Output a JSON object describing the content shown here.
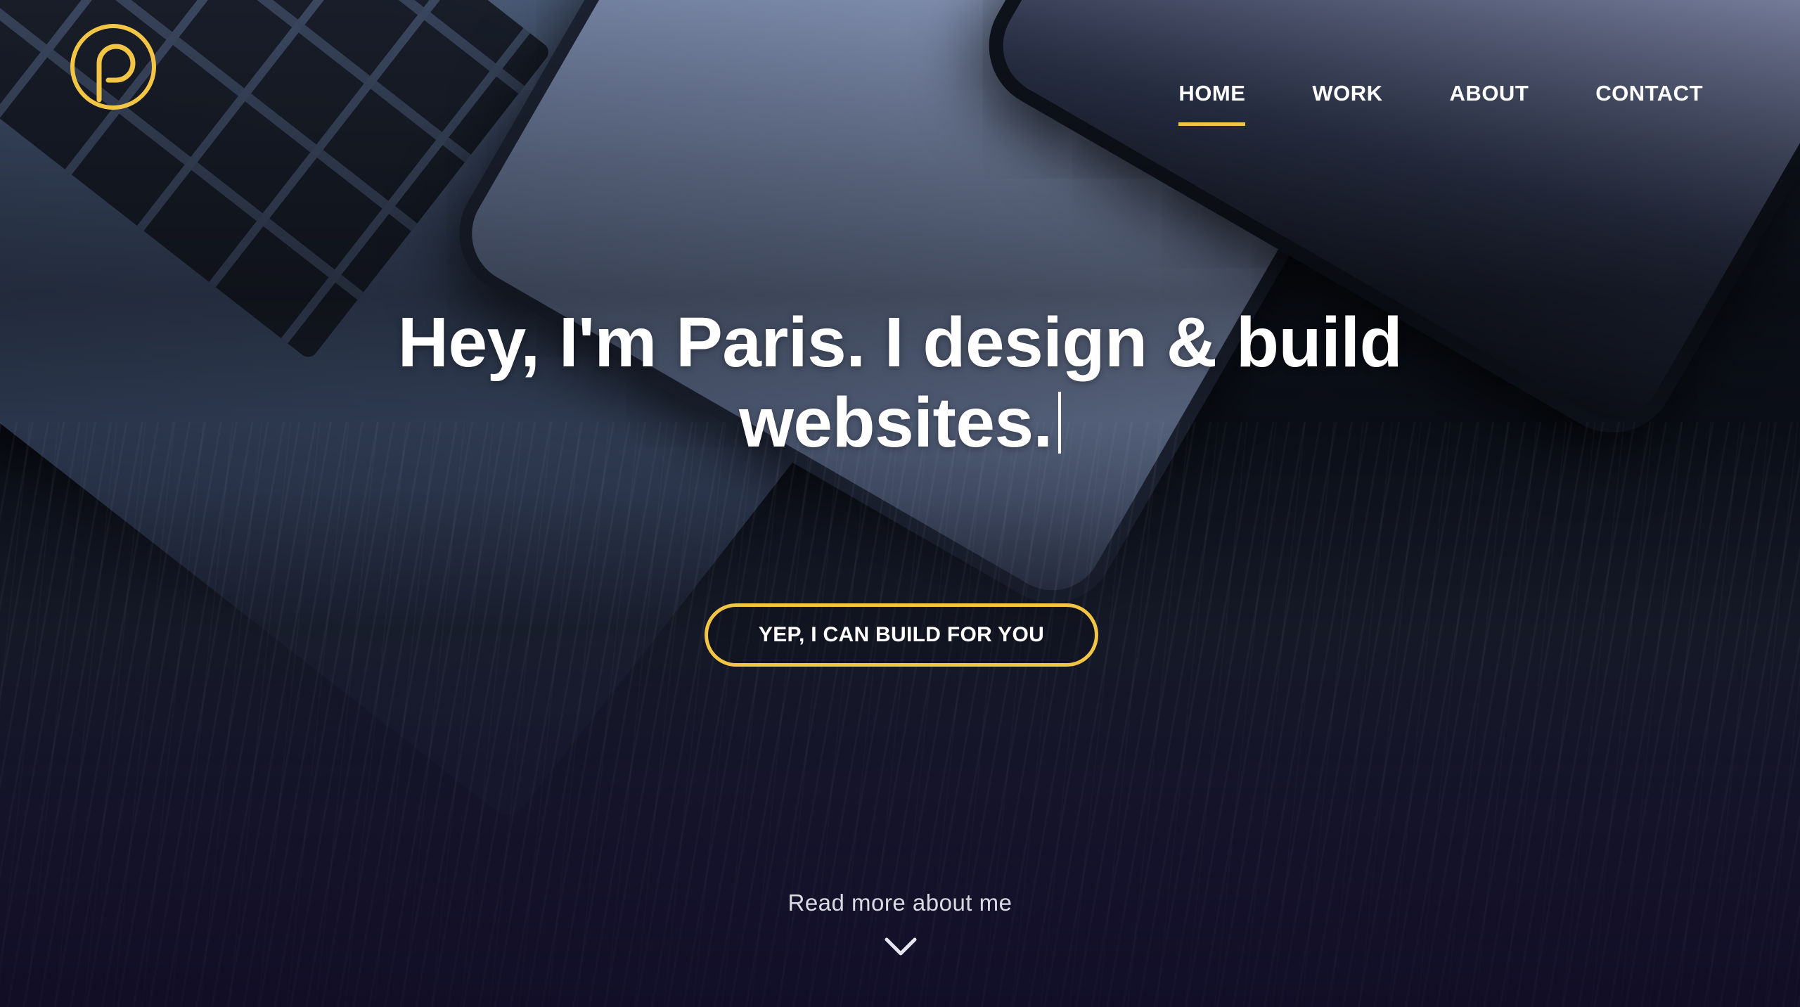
{
  "brand": {
    "logo_icon": "p-monogram-logo-icon",
    "accent": "#f3c545"
  },
  "nav": {
    "items": [
      {
        "label": "HOME",
        "active": true
      },
      {
        "label": "WORK",
        "active": false
      },
      {
        "label": "ABOUT",
        "active": false
      },
      {
        "label": "CONTACT",
        "active": false
      }
    ]
  },
  "hero": {
    "headline_line1": "Hey, I'm Paris. I design & build",
    "headline_line2": "websites.",
    "cta_label": "YEP, I CAN BUILD FOR YOU",
    "read_more": "Read more about me",
    "scroll_icon": "chevron-down-icon"
  }
}
